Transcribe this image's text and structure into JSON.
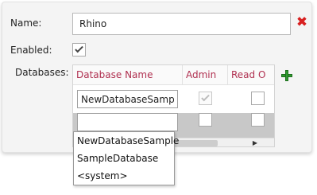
{
  "form": {
    "name_label": "Name:",
    "name_value": "Rhino",
    "enabled_label": "Enabled:",
    "enabled_checked": true,
    "databases_label": "Databases:"
  },
  "grid": {
    "columns": [
      "Database Name",
      "Admin",
      "Read O"
    ],
    "rows": [
      {
        "database_name": "NewDatabaseSample",
        "admin": true,
        "read_only": false,
        "selected": false
      },
      {
        "database_name": "",
        "admin": false,
        "read_only": false,
        "selected": true
      }
    ]
  },
  "dropdown": {
    "options": [
      "NewDatabaseSample",
      "SampleDatabase",
      "<system>"
    ]
  },
  "colors": {
    "header_text": "#b03050",
    "remove_icon": "#d82020",
    "add_icon": "#2f9a2f",
    "selected_row": "#c8c8c8"
  },
  "icons": {
    "remove": "close-icon",
    "add": "plus-icon"
  }
}
